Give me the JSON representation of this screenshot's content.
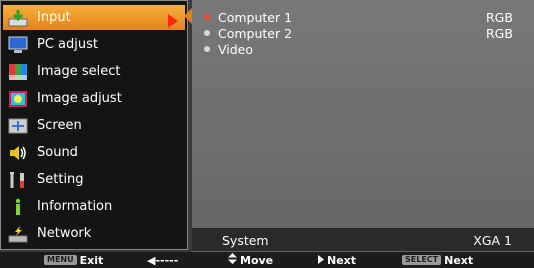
{
  "menu": {
    "items": [
      {
        "label": "Input",
        "icon": "input-icon"
      },
      {
        "label": "PC adjust",
        "icon": "monitor-icon"
      },
      {
        "label": "Image select",
        "icon": "image-select-icon"
      },
      {
        "label": "Image adjust",
        "icon": "image-adjust-icon"
      },
      {
        "label": "Screen",
        "icon": "screen-icon"
      },
      {
        "label": "Sound",
        "icon": "speaker-icon"
      },
      {
        "label": "Setting",
        "icon": "wrench-icon"
      },
      {
        "label": "Information",
        "icon": "info-icon"
      },
      {
        "label": "Network",
        "icon": "network-icon"
      }
    ],
    "selected_index": 0
  },
  "sources": [
    {
      "label": "Computer 1",
      "value": "RGB",
      "active": true
    },
    {
      "label": "Computer 2",
      "value": "RGB",
      "active": false
    },
    {
      "label": "Video",
      "value": "",
      "active": false
    }
  ],
  "system": {
    "label": "System",
    "value": "XGA 1"
  },
  "guide": {
    "exit_key": "MENU",
    "exit_label": "Exit",
    "back_arrow": "◀-----",
    "move_label": "Move",
    "next_arrow_label": "Next",
    "select_key": "SELECT",
    "select_label": "Next"
  },
  "colors": {
    "selection": "#f09a22",
    "active_dot": "#ff4433",
    "menu_bg": "#141414",
    "panel_bg": "#6e6e6e"
  }
}
